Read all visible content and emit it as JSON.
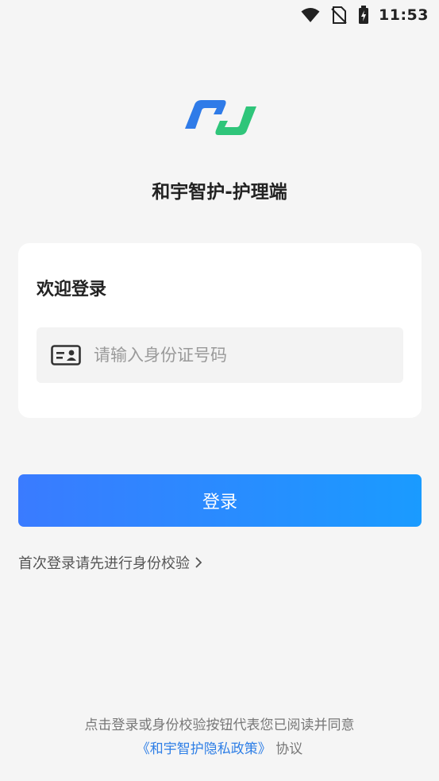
{
  "status_bar": {
    "time": "11:53",
    "icons": [
      "wifi-icon",
      "no-sim-icon",
      "battery-charging-icon"
    ]
  },
  "app": {
    "title": "和宇智护-护理端",
    "logo_colors": {
      "blue": "#2f7be8",
      "green": "#2fc57a"
    }
  },
  "login_card": {
    "title": "欢迎登录",
    "id_input": {
      "placeholder": "请输入身份证号码",
      "value": "",
      "icon": "id-card-icon"
    }
  },
  "login_button": {
    "label": "登录",
    "gradient": [
      "#3a7bff",
      "#1a9bff"
    ]
  },
  "verify_link": {
    "label": "首次登录请先进行身份校验",
    "icon": "chevron-right-icon"
  },
  "agreement": {
    "line1": "点击登录或身份校验按钮代表您已阅读并同意",
    "policy_link": "《和宇智护隐私政策》",
    "suffix": "协议"
  }
}
